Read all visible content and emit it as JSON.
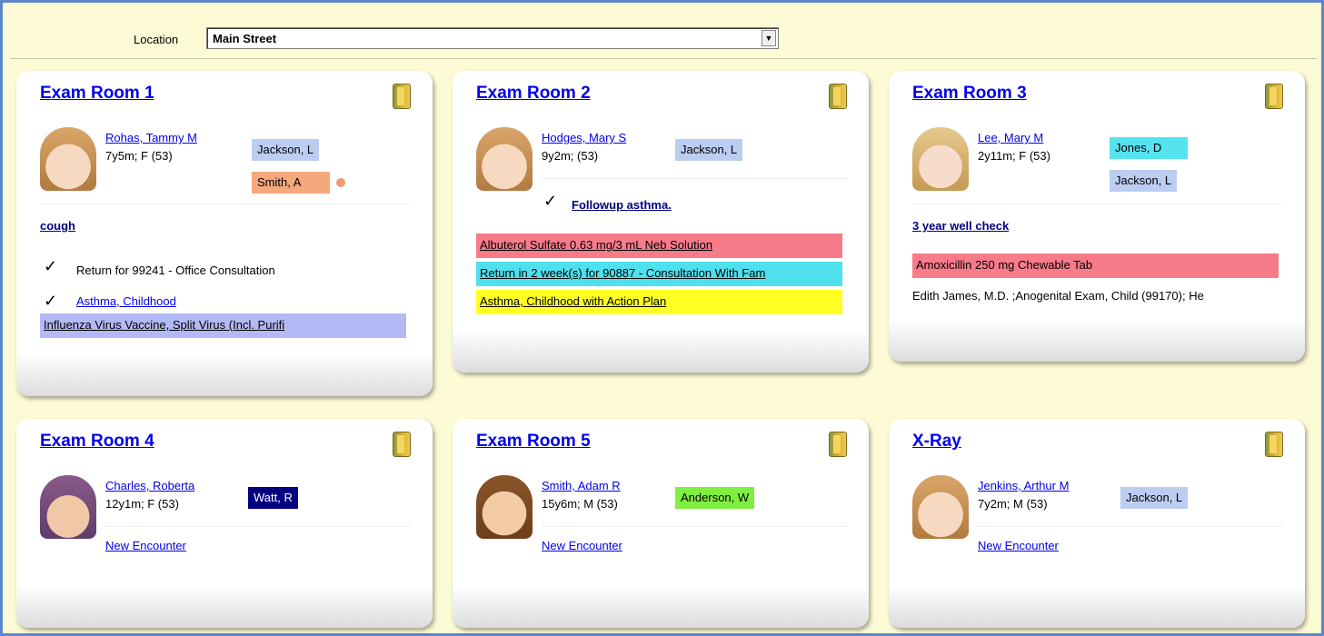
{
  "location": {
    "label": "Location",
    "value": "Main Street"
  },
  "rooms": [
    {
      "title": "Exam Room 1",
      "patient": {
        "name": "Rohas, Tammy M",
        "age": "7y5m; F (53)"
      },
      "providers": [
        "Jackson, L",
        "Smith, A"
      ],
      "complaint": "cough",
      "items": [
        "Return for 99241 - Office Consultation",
        "Asthma, Childhood"
      ],
      "bars": [
        "Influenza Virus Vaccine, Split Virus (Incl. Purifi"
      ]
    },
    {
      "title": "Exam Room 2",
      "patient": {
        "name": "Hodges, Mary S",
        "age": "9y2m; (53)"
      },
      "providers": [
        "Jackson, L"
      ],
      "items": [
        "Followup asthma."
      ],
      "bars": [
        "Albuterol Sulfate 0.63 mg/3 mL Neb Solution",
        "Return in 2 week(s) for 90887 - Consultation With Fam",
        "Asthma, Childhood with Action Plan"
      ]
    },
    {
      "title": "Exam Room 3",
      "patient": {
        "name": "Lee, Mary M",
        "age": "2y11m; F (53)"
      },
      "providers": [
        "Jones, D",
        "Jackson, L"
      ],
      "complaint": "3 year well check",
      "bars": [
        "Amoxicillin 250 mg Chewable Tab"
      ],
      "note": "Edith James, M.D. ;Anogenital Exam, Child (99170); He"
    },
    {
      "title": "Exam Room 4",
      "patient": {
        "name": "Charles, Roberta",
        "age": "12y1m; F (53)"
      },
      "providers": [
        "Watt, R"
      ],
      "new_encounter": "New Encounter"
    },
    {
      "title": "Exam Room 5",
      "patient": {
        "name": "Smith, Adam R",
        "age": "15y6m; M (53)"
      },
      "providers": [
        "Anderson, W"
      ],
      "new_encounter": "New Encounter"
    },
    {
      "title": "X-Ray",
      "patient": {
        "name": "Jenkins, Arthur M",
        "age": "7y2m; M (53)"
      },
      "providers": [
        "Jackson, L"
      ],
      "new_encounter": "New Encounter"
    }
  ],
  "colors": {
    "provider_blue": "#bccdf2",
    "provider_orange": "#f4a87c",
    "provider_cyan": "#56e3f0",
    "provider_navy": "#000080",
    "provider_green": "#80f040",
    "bar_pink": "#f87b8a",
    "bar_cyan": "#4fe0ee",
    "bar_yellow": "#ffff22",
    "bar_lavender": "#b2b9f4"
  }
}
